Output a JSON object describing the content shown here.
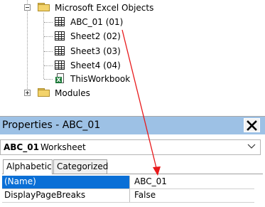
{
  "project_tree": {
    "folders": [
      {
        "label": "Microsoft Excel Objects",
        "state": "expanded"
      },
      {
        "label": "Modules",
        "state": "collapsed"
      }
    ],
    "items": [
      {
        "label": "ABC_01 (01)",
        "icon": "worksheet-icon"
      },
      {
        "label": "Sheet2 (02)",
        "icon": "worksheet-icon"
      },
      {
        "label": "Sheet3 (03)",
        "icon": "worksheet-icon"
      },
      {
        "label": "Sheet4 (04)",
        "icon": "worksheet-icon"
      },
      {
        "label": "ThisWorkbook",
        "icon": "workbook-icon"
      }
    ]
  },
  "properties_pane": {
    "title": "Properties - ABC_01",
    "close_icon": "close-icon",
    "object_select": {
      "name": "ABC_01",
      "type": "Worksheet"
    },
    "tabs": [
      {
        "label": "Alphabetic",
        "active": true
      },
      {
        "label": "Categorized",
        "active": false
      }
    ],
    "rows": [
      {
        "name": "(Name)",
        "value": "ABC_01",
        "selected": true
      },
      {
        "name": "DisplayPageBreaks",
        "value": "False",
        "selected": false
      }
    ]
  },
  "annotation": {
    "color": "#e8191b"
  },
  "colors": {
    "header_bg": "#9dc1e5",
    "selection": "#0a6fd6"
  }
}
